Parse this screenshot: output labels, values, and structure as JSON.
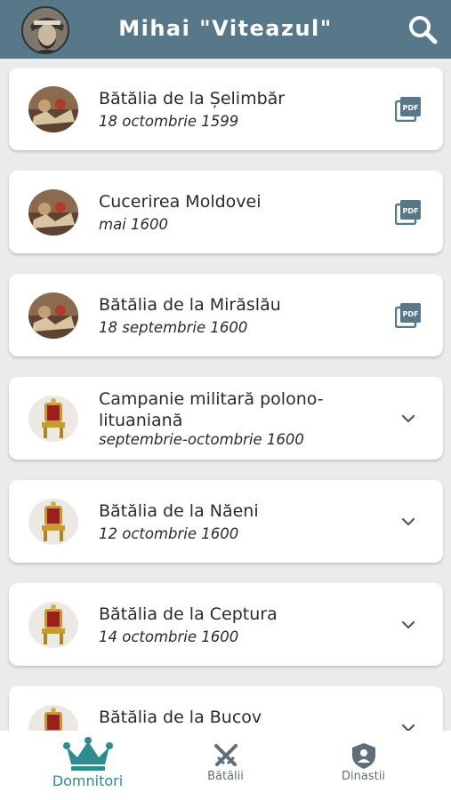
{
  "app": {
    "title": "Mihai \"Viteazul\""
  },
  "battles": [
    {
      "title": "Bătălia de la Șelimbăr",
      "date": "18 octombrie 1599",
      "action_icon": "pdf-icon",
      "thumb": "battle-painting"
    },
    {
      "title": "Cucerirea Moldovei",
      "date": "mai 1600",
      "action_icon": "pdf-icon",
      "thumb": "battle-painting"
    },
    {
      "title": "Bătălia de la Mirăslău",
      "date": "18 septembrie 1600",
      "action_icon": "pdf-icon",
      "thumb": "battle-painting"
    },
    {
      "title": "Campanie militară polono-lituaniană",
      "date": "septembrie-octombrie 1600",
      "action_icon": "chevron-down-icon",
      "thumb": "throne"
    },
    {
      "title": "Bătălia de la Năeni",
      "date": "12 octombrie 1600",
      "action_icon": "chevron-down-icon",
      "thumb": "throne"
    },
    {
      "title": "Bătălia de la Ceptura",
      "date": "14 octombrie 1600",
      "action_icon": "chevron-down-icon",
      "thumb": "throne"
    },
    {
      "title": "Bătălia de la Bucov",
      "date": "",
      "action_icon": "chevron-down-icon",
      "thumb": "throne"
    }
  ],
  "nav": {
    "items": [
      {
        "label": "Domnitori",
        "icon": "crown-icon",
        "active": true
      },
      {
        "label": "Bătălii",
        "icon": "crossed-swords-icon",
        "active": false
      },
      {
        "label": "Dinastii",
        "icon": "shield-icon",
        "active": false
      }
    ]
  },
  "colors": {
    "appbar": "#577888",
    "background": "#ebebeb",
    "accent": "#2e8c8f",
    "nav_inactive": "#5f6f78",
    "pdf_icon": "#577888"
  }
}
